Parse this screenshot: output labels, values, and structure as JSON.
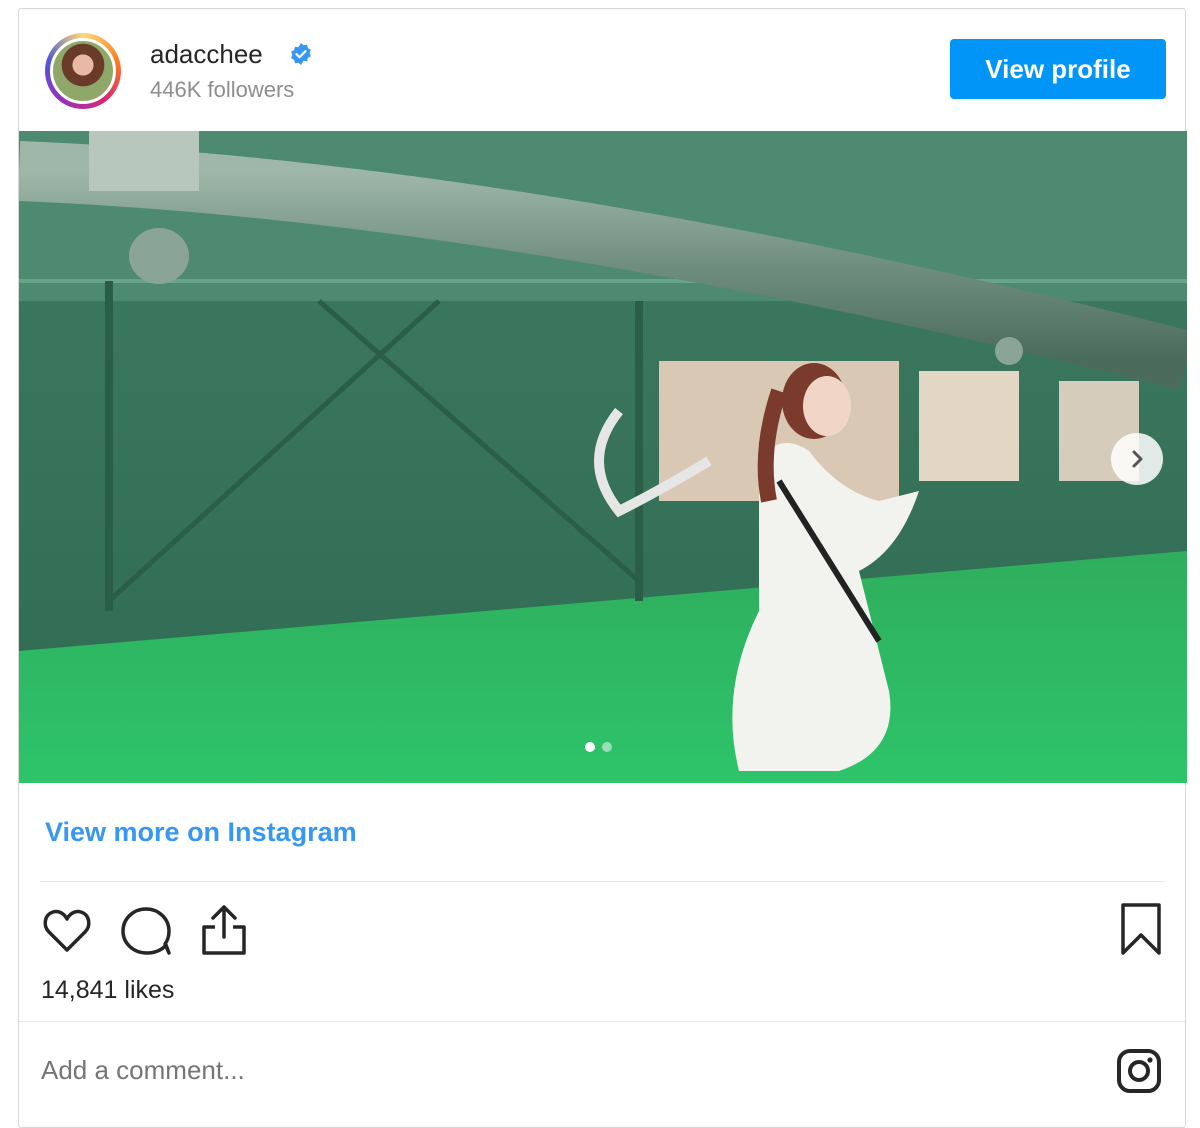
{
  "header": {
    "username": "adacchee",
    "verified_icon": "verified-badge-icon",
    "followers": "446K followers",
    "view_profile_label": "View profile",
    "accent_color": "#0095f6"
  },
  "media": {
    "carousel_dots": 2,
    "active_dot": 1,
    "next_icon": "chevron-right-icon"
  },
  "view_more_label": "View more on Instagram",
  "actions": {
    "like_icon": "heart-icon",
    "comment_icon": "comment-icon",
    "share_icon": "share-icon",
    "save_icon": "bookmark-icon"
  },
  "likes": "14,841 likes",
  "comment": {
    "placeholder": "Add a comment..."
  },
  "footer_icon": "instagram-logo-icon"
}
